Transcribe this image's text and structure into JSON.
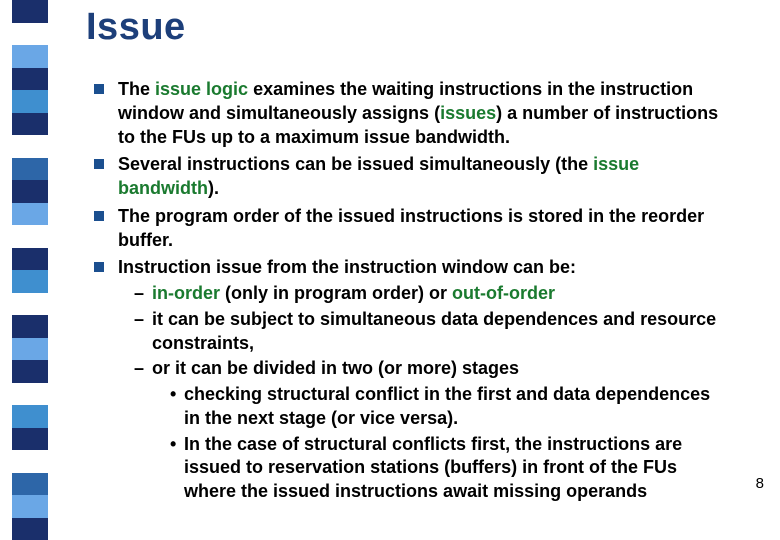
{
  "colors": {
    "title": "#1d3f7a",
    "bullet": "#1b4f8f",
    "accent_green": "#1a7a2f"
  },
  "sidebar_segments": [
    "#1a2f6b",
    "#ffffff",
    "#6aa7e6",
    "#1a2f6b",
    "#3f8fcf",
    "#1a2f6b",
    "#ffffff",
    "#2d66a8",
    "#1a2f6b",
    "#6aa7e6",
    "#ffffff",
    "#1a2f6b",
    "#3f8fcf",
    "#ffffff",
    "#1a2f6b",
    "#6aa7e6",
    "#1a2f6b",
    "#ffffff",
    "#3f8fcf",
    "#1a2f6b",
    "#ffffff",
    "#2d66a8",
    "#6aa7e6",
    "#1a2f6b"
  ],
  "title": "Issue",
  "page_number": "8",
  "bullets": [
    {
      "parts": [
        {
          "t": "The "
        },
        {
          "t": "issue logic",
          "c": "green"
        },
        {
          "t": " examines the waiting instructions in the instruction window and simultaneously assigns ("
        },
        {
          "t": "issues",
          "c": "green"
        },
        {
          "t": ") a number of instructions to the FUs up to a maximum issue bandwidth."
        }
      ]
    },
    {
      "parts": [
        {
          "t": "Several instructions can be issued simultaneously (the "
        },
        {
          "t": "issue bandwidth",
          "c": "green"
        },
        {
          "t": ")."
        }
      ]
    },
    {
      "parts": [
        {
          "t": "The program order of the issued instructions is stored in the reorder buffer."
        }
      ]
    },
    {
      "parts": [
        {
          "t": "Instruction issue from the instruction window can be:"
        }
      ],
      "sub": [
        {
          "parts": [
            {
              "t": "in-order",
              "c": "green"
            },
            {
              "t": " (only in program order) or "
            },
            {
              "t": "out-of-order",
              "c": "green"
            }
          ]
        },
        {
          "parts": [
            {
              "t": "it can be subject to simultaneous data dependences and resource constraints,"
            }
          ]
        },
        {
          "parts": [
            {
              "t": "or it can be divided in two (or more) stages"
            }
          ],
          "sub": [
            {
              "parts": [
                {
                  "t": "checking structural conflict in the first and data dependences in the next stage (or vice versa)."
                }
              ]
            },
            {
              "parts": [
                {
                  "t": "In the case of structural conflicts first, the instructions are issued to reservation stations (buffers) in front of the FUs where the issued instructions await missing operands"
                }
              ]
            }
          ]
        }
      ]
    }
  ]
}
